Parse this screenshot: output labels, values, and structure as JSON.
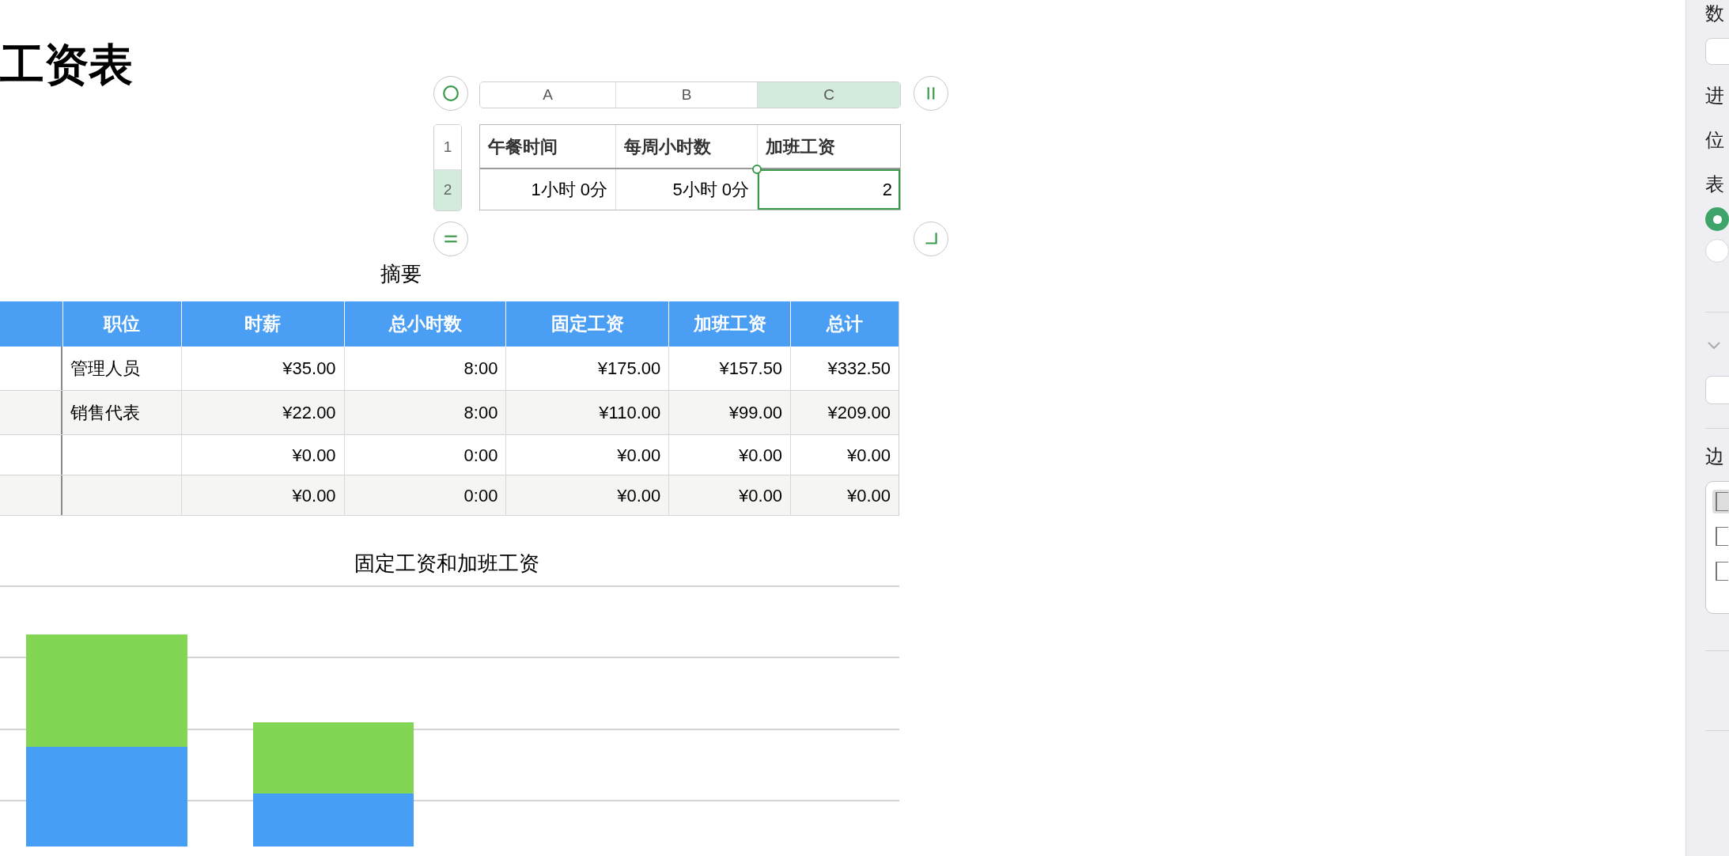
{
  "title": "工资表",
  "small_table": {
    "column_headers": [
      {
        "label": "A",
        "selected": false
      },
      {
        "label": "B",
        "selected": false
      },
      {
        "label": "C",
        "selected": true
      }
    ],
    "rows": [
      {
        "header": "1",
        "selected": false,
        "cells": [
          {
            "text": "午餐时间",
            "selected": false
          },
          {
            "text": "每周小时数",
            "selected": false
          },
          {
            "text": "加班工资",
            "selected": false
          }
        ]
      },
      {
        "header": "2",
        "selected": true,
        "cells": [
          {
            "text": "1小时 0分",
            "selected": false
          },
          {
            "text": "5小时 0分",
            "selected": false
          },
          {
            "text": "2",
            "selected": true
          }
        ]
      }
    ]
  },
  "summary_table": {
    "title": "摘要",
    "columns": [
      "职位",
      "时薪",
      "总小时数",
      "固定工资",
      "加班工资",
      "总计"
    ],
    "rows": [
      {
        "position": "管理人员",
        "values": [
          "¥35.00",
          "8:00",
          "¥175.00",
          "¥157.50",
          "¥332.50"
        ]
      },
      {
        "position": "销售代表",
        "values": [
          "¥22.00",
          "8:00",
          "¥110.00",
          "¥99.00",
          "¥209.00"
        ]
      },
      {
        "values": [
          "¥0.00",
          "0:00",
          "¥0.00",
          "¥0.00",
          "¥0.00"
        ]
      },
      {
        "values": [
          "¥0.00",
          "0:00",
          "¥0.00",
          "¥0.00",
          "¥0.00"
        ]
      }
    ]
  },
  "chart": {
    "title": "固定工资和加班工资"
  },
  "sidebar": {
    "labels": [
      "数",
      "进",
      "位",
      "表"
    ],
    "radios": [
      {
        "selected": true
      },
      {
        "selected": false
      }
    ],
    "border_label": "边",
    "border_options": [
      {
        "selected": true
      },
      {
        "selected": false
      },
      {
        "selected": false
      }
    ]
  }
}
